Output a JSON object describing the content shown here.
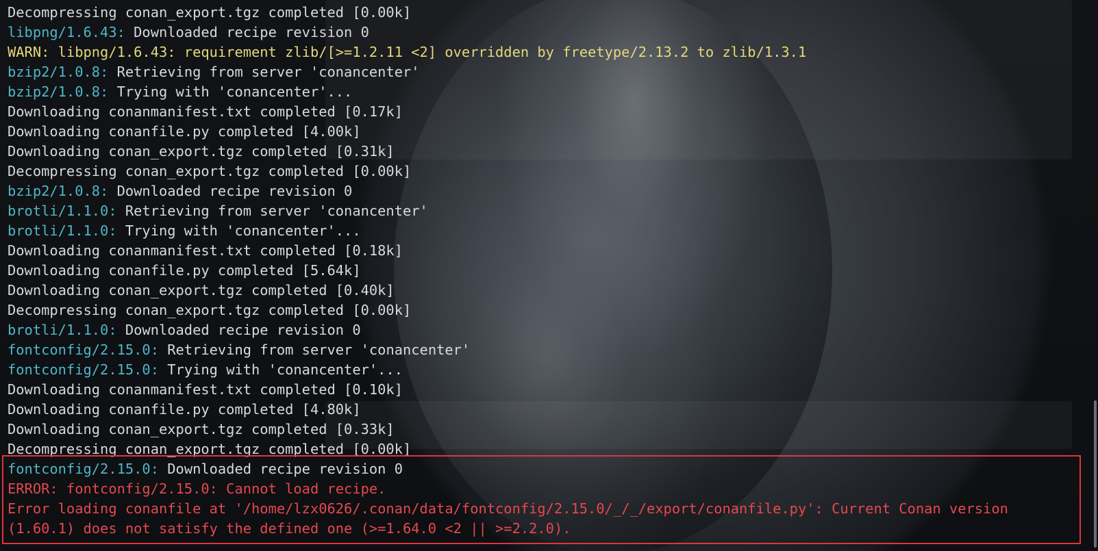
{
  "terminal": {
    "lines": [
      [
        {
          "t": "Decompressing conan_export.tgz completed [0.00k]",
          "c": "w"
        }
      ],
      [
        {
          "t": "libpng/1.6.43:",
          "c": "c"
        },
        {
          "t": " Downloaded recipe revision 0",
          "c": "w"
        }
      ],
      [
        {
          "t": "WARN: libpng/1.6.43: requirement zlib/[>=1.2.11 <2] overridden by freetype/2.13.2 to zlib/1.3.1",
          "c": "y"
        }
      ],
      [
        {
          "t": "bzip2/1.0.8:",
          "c": "c"
        },
        {
          "t": " Retrieving from server 'conancenter'",
          "c": "w"
        }
      ],
      [
        {
          "t": "bzip2/1.0.8:",
          "c": "c"
        },
        {
          "t": " Trying with 'conancenter'...",
          "c": "w"
        }
      ],
      [
        {
          "t": "Downloading conanmanifest.txt completed [0.17k]",
          "c": "w"
        }
      ],
      [
        {
          "t": "Downloading conanfile.py completed [4.00k]",
          "c": "w"
        }
      ],
      [
        {
          "t": "Downloading conan_export.tgz completed [0.31k]",
          "c": "w"
        }
      ],
      [
        {
          "t": "Decompressing conan_export.tgz completed [0.00k]",
          "c": "w"
        }
      ],
      [
        {
          "t": "bzip2/1.0.8:",
          "c": "c"
        },
        {
          "t": " Downloaded recipe revision 0",
          "c": "w"
        }
      ],
      [
        {
          "t": "brotli/1.1.0:",
          "c": "c"
        },
        {
          "t": " Retrieving from server 'conancenter'",
          "c": "w"
        }
      ],
      [
        {
          "t": "brotli/1.1.0:",
          "c": "c"
        },
        {
          "t": " Trying with 'conancenter'...",
          "c": "w"
        }
      ],
      [
        {
          "t": "Downloading conanmanifest.txt completed [0.18k]",
          "c": "w"
        }
      ],
      [
        {
          "t": "Downloading conanfile.py completed [5.64k]",
          "c": "w"
        }
      ],
      [
        {
          "t": "Downloading conan_export.tgz completed [0.40k]",
          "c": "w"
        }
      ],
      [
        {
          "t": "Decompressing conan_export.tgz completed [0.00k]",
          "c": "w"
        }
      ],
      [
        {
          "t": "brotli/1.1.0:",
          "c": "c"
        },
        {
          "t": " Downloaded recipe revision 0",
          "c": "w"
        }
      ],
      [
        {
          "t": "fontconfig/2.15.0:",
          "c": "c"
        },
        {
          "t": " Retrieving from server 'conancenter'",
          "c": "w"
        }
      ],
      [
        {
          "t": "fontconfig/2.15.0:",
          "c": "c"
        },
        {
          "t": " Trying with 'conancenter'...",
          "c": "w"
        }
      ],
      [
        {
          "t": "Downloading conanmanifest.txt completed [0.10k]",
          "c": "w"
        }
      ],
      [
        {
          "t": "Downloading conanfile.py completed [4.80k]",
          "c": "w"
        }
      ],
      [
        {
          "t": "Downloading conan_export.tgz completed [0.33k]",
          "c": "w"
        }
      ],
      [
        {
          "t": "Decompressing conan_export.tgz completed [0.00k]",
          "c": "w"
        }
      ],
      [
        {
          "t": "fontconfig/2.15.0:",
          "c": "c"
        },
        {
          "t": " Downloaded recipe revision 0",
          "c": "w"
        }
      ],
      [
        {
          "t": "ERROR: fontconfig/2.15.0: Cannot load recipe.",
          "c": "r"
        }
      ],
      [
        {
          "t": "Error loading conanfile at '/home/lzx0626/.conan/data/fontconfig/2.15.0/_/_/export/conanfile.py': Current Conan version",
          "c": "r"
        }
      ],
      [
        {
          "t": "(1.60.1) does not satisfy the defined one (>=1.64.0 <2 || >=2.2.0).",
          "c": "r"
        }
      ]
    ]
  },
  "colors": {
    "output_text": "#d7dadd",
    "package_ref": "#4fb6c8",
    "warning": "#e5d77a",
    "error": "#e5484d",
    "highlight_border": "#e0353b"
  }
}
